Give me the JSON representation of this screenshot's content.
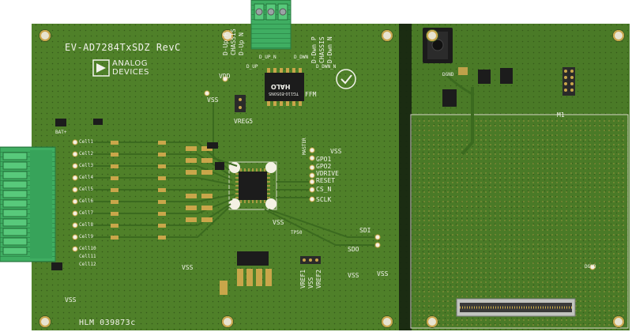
{
  "board": {
    "title": "EV-AD7284TxSDZ RevC",
    "brand_line1": "ANALOG",
    "brand_line2": "DEVICES",
    "assembly_number": "HLM 039873c",
    "module_label": "M1"
  },
  "labels": {
    "vdd": "VDD",
    "vss": "VSS",
    "vreg5": "VREG5",
    "d_up_n": "D_UP_N",
    "d_up": "D_UP",
    "d_dwn": "D_DWN",
    "d_dwn_n": "D_DWN_N",
    "ffm": "FFM",
    "master": "MASTER",
    "gpo1": "GPO1",
    "gpo2": "GPO2",
    "vdrive": "VDRIVE",
    "reset": "RESET",
    "cs_n": "CS_N",
    "sclk": "SCLK",
    "sdi": "SDI",
    "sdo": "SDO",
    "vref1": "VREF1",
    "vref2": "VREF2",
    "dgnd": "DGND",
    "bat": "BAT+",
    "tp50": "TP50"
  },
  "connector_labels": {
    "top_left": [
      "D-Up P",
      "CHASSIS",
      "D-Up N"
    ],
    "top_right": [
      "D-Dwn P",
      "CHASSIS",
      "D-Dwn N"
    ]
  },
  "channels": [
    "Cell1",
    "Cell2",
    "Cell3",
    "Cell4",
    "Cell5",
    "Cell6",
    "Cell7",
    "Cell8",
    "Cell9",
    "Cell10",
    "Cell11",
    "Cell12"
  ],
  "chips": {
    "transformer_line1": "HALO",
    "transformer_line2": "TG110-E050N5"
  },
  "colors": {
    "pcb_green": "#4e7e2a",
    "pcb_green_dark": "#3d6520",
    "terminal_green": "#45b86a",
    "pad_gold": "#c9a64a",
    "silkscreen": "#f2f2ec",
    "ic_black": "#1c1c1c"
  }
}
